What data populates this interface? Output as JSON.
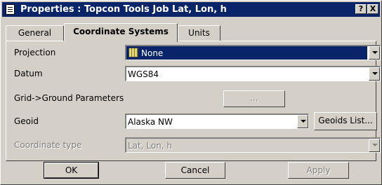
{
  "window": {
    "title": "Properties : Topcon Tools Job Lat, Lon, h",
    "help_label": "?",
    "close_label": "X"
  },
  "tabs": [
    {
      "label": "General"
    },
    {
      "label": "Coordinate Systems"
    },
    {
      "label": "Units"
    }
  ],
  "form": {
    "projection": {
      "label": "Projection",
      "value": "None",
      "icon": "grid-icon"
    },
    "datum": {
      "label": "Datum",
      "value": "WGS84"
    },
    "grid_ground": {
      "label": "Grid->Ground Parameters",
      "button_label": "..."
    },
    "geoid": {
      "label": "Geoid",
      "value": "Alaska NW",
      "button_label": "Geoids List..."
    },
    "coordinate_type": {
      "label": "Coordinate type",
      "value": "Lat, Lon, h"
    }
  },
  "buttons": {
    "ok": "OK",
    "cancel": "Cancel",
    "apply": "Apply"
  }
}
